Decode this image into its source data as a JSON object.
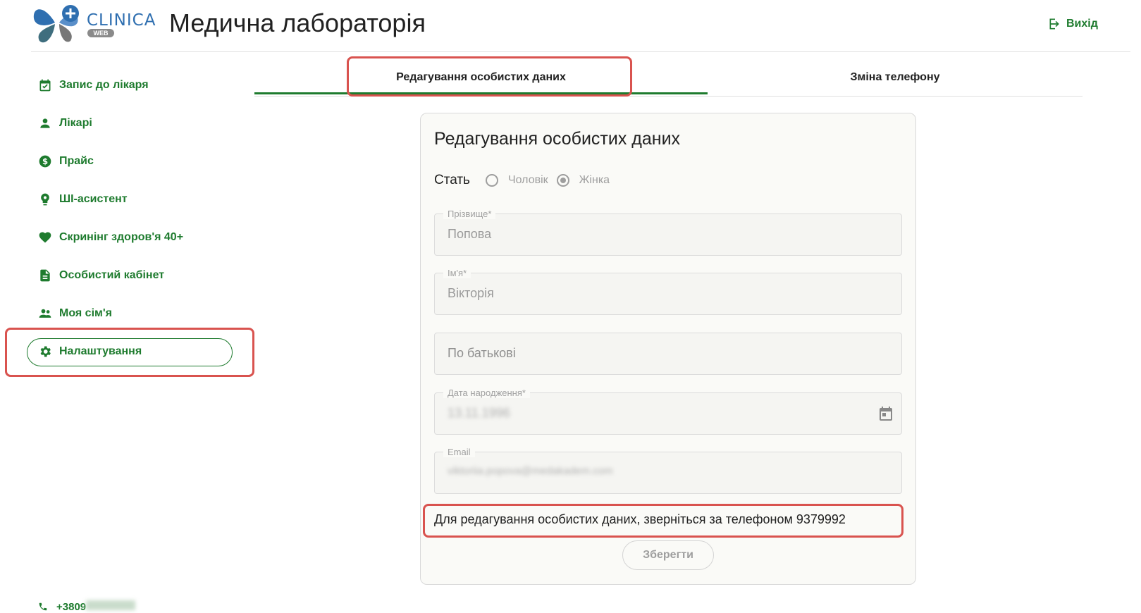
{
  "header": {
    "logo_text": "CLINICA",
    "logo_sub": "WEB",
    "title": "Медична лабораторія",
    "logout_label": "Вихід"
  },
  "sidebar": {
    "items": [
      {
        "label": "Запис до лікаря",
        "icon": "calendar-check-icon"
      },
      {
        "label": "Лікарі",
        "icon": "person-icon"
      },
      {
        "label": "Прайс",
        "icon": "dollar-circle-icon"
      },
      {
        "label": "ШІ-асистент",
        "icon": "head-bulb-icon"
      },
      {
        "label": "Скринінг здоров'я 40+",
        "icon": "heart-icon"
      },
      {
        "label": "Особистий кабінет",
        "icon": "document-icon"
      },
      {
        "label": "Моя сім'я",
        "icon": "people-icon"
      },
      {
        "label": "Налаштування",
        "icon": "gear-icon",
        "active": true
      }
    ],
    "phone_prefix": "+3809"
  },
  "tabs": [
    {
      "label": "Редагування особистих даних",
      "active": true
    },
    {
      "label": "Зміна телефону",
      "active": false
    }
  ],
  "form": {
    "title": "Редагування особистих даних",
    "gender_label": "Стать",
    "gender_options": [
      "Чоловік",
      "Жінка"
    ],
    "gender_selected": "Жінка",
    "fields": {
      "last_name": {
        "label": "Прізвище*",
        "value": "Попова"
      },
      "first_name": {
        "label": "Ім'я*",
        "value": "Вікторія"
      },
      "patronymic": {
        "placeholder": "По батькові"
      },
      "birth_date": {
        "label": "Дата народження*",
        "value": "13.11.1996"
      },
      "email": {
        "label": "Email",
        "value": "viktoriia.popova@medakadem.com"
      }
    },
    "notice": "Для редагування особистих даних, зверніться за телефоном 9379992",
    "save_label": "Зберегти"
  },
  "colors": {
    "accent": "#1e7b2e",
    "highlight": "#d9534f"
  }
}
